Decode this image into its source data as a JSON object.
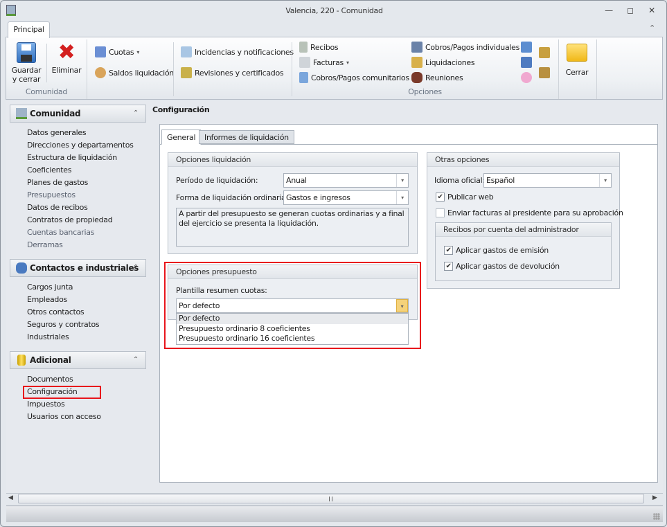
{
  "window": {
    "title": "Valencia, 220 - Comunidad",
    "minimize": "▭",
    "restore": "◻",
    "close": "✕"
  },
  "ribbon": {
    "tab": "Principal",
    "collapse": "⌃",
    "groups": {
      "comunidad": {
        "label": "Comunidad",
        "guardar": "Guardar\ny cerrar",
        "eliminar": "Eliminar"
      },
      "opciones": {
        "label": "Opciones",
        "cuotas": "Cuotas",
        "saldos": "Saldos liquidación",
        "incidencias": "Incidencias y notificaciones",
        "revisiones": "Revisiones y certificados",
        "recibos": "Recibos",
        "facturas": "Facturas",
        "cobros_comunitarios": "Cobros/Pagos comunitarios",
        "cobros_individuales": "Cobros/Pagos individuales",
        "liquidaciones": "Liquidaciones",
        "reuniones": "Reuniones"
      },
      "cerrar": {
        "label": "Cerrar"
      }
    },
    "dropdown_caret": "▾"
  },
  "sidebar": {
    "groups": [
      {
        "title": "Comunidad",
        "items": [
          {
            "label": "Datos generales",
            "enabled": true
          },
          {
            "label": "Direcciones y departamentos",
            "enabled": true
          },
          {
            "label": "Estructura de liquidación",
            "enabled": true
          },
          {
            "label": "Coeficientes",
            "enabled": true
          },
          {
            "label": "Planes de gastos",
            "enabled": true
          },
          {
            "label": "Presupuestos",
            "enabled": false
          },
          {
            "label": "Datos de recibos",
            "enabled": true
          },
          {
            "label": "Contratos de propiedad",
            "enabled": true
          },
          {
            "label": "Cuentas bancarias",
            "enabled": false
          },
          {
            "label": "Derramas",
            "enabled": false
          }
        ]
      },
      {
        "title": "Contactos e industriales",
        "items": [
          {
            "label": "Cargos junta"
          },
          {
            "label": "Empleados"
          },
          {
            "label": "Otros contactos"
          },
          {
            "label": "Seguros y contratos"
          },
          {
            "label": "Industriales"
          }
        ]
      },
      {
        "title": "Adicional",
        "items": [
          {
            "label": "Documentos"
          },
          {
            "label": "Configuración",
            "selected": true
          },
          {
            "label": "Impuestos"
          },
          {
            "label": "Usuarios con acceso"
          }
        ]
      }
    ],
    "chevron": "⌃"
  },
  "main": {
    "title": "Configuración",
    "tabs": [
      {
        "label": "General",
        "active": true
      },
      {
        "label": "Informes de liquidación"
      }
    ],
    "liquidacion": {
      "title": "Opciones liquidación",
      "periodo_label": "Período de liquidación:",
      "periodo_value": "Anual",
      "forma_label": "Forma de liquidación ordinaria:",
      "forma_value": "Gastos e ingresos",
      "description": "A partir del presupuesto se generan cuotas ordinarias y a final del ejercicio se presenta la liquidación."
    },
    "presupuesto": {
      "title": "Opciones presupuesto",
      "plantilla_label": "Plantilla resumen cuotas:",
      "plantilla_value": "Por defecto",
      "options": [
        "Por defecto",
        "Presupuesto ordinario 8 coeficientes",
        "Presupuesto ordinario 16 coeficientes"
      ]
    },
    "otras": {
      "title": "Otras opciones",
      "idioma_label": "Idioma oficial:",
      "idioma_value": "Español",
      "publicar_web": {
        "label": "Publicar web",
        "checked": true
      },
      "enviar_facturas": {
        "label": "Enviar facturas al presidente para su aprobación",
        "checked": false
      },
      "recibos": {
        "title": "Recibos por cuenta del administrador",
        "emision": {
          "label": "Aplicar gastos de emisión",
          "checked": true
        },
        "devolucion": {
          "label": "Aplicar gastos de devolución",
          "checked": true
        }
      }
    }
  },
  "colors": {
    "highlight": "#e8141b",
    "accent_dropdown": "#f5d27a"
  },
  "check_mark": "✔"
}
